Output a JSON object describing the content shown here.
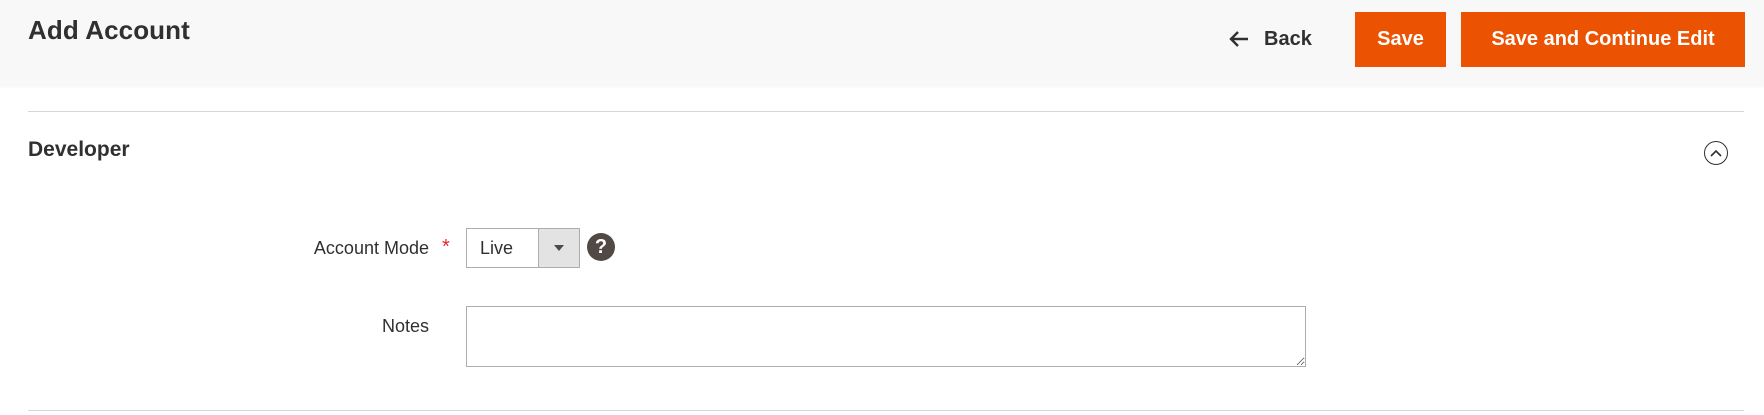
{
  "header": {
    "title": "Add Account",
    "back_label": "Back",
    "save_label": "Save",
    "save_continue_label": "Save and Continue Edit",
    "accent_color": "#eb5202"
  },
  "section": {
    "title": "Developer",
    "toggle_icon": "chevron-up-circle-icon",
    "fields": {
      "account_mode": {
        "label": "Account Mode",
        "required_mark": "*",
        "value": "Live",
        "help_icon": "question-circle-icon",
        "help_glyph": "?"
      },
      "notes": {
        "label": "Notes",
        "value": "",
        "placeholder": ""
      }
    }
  }
}
